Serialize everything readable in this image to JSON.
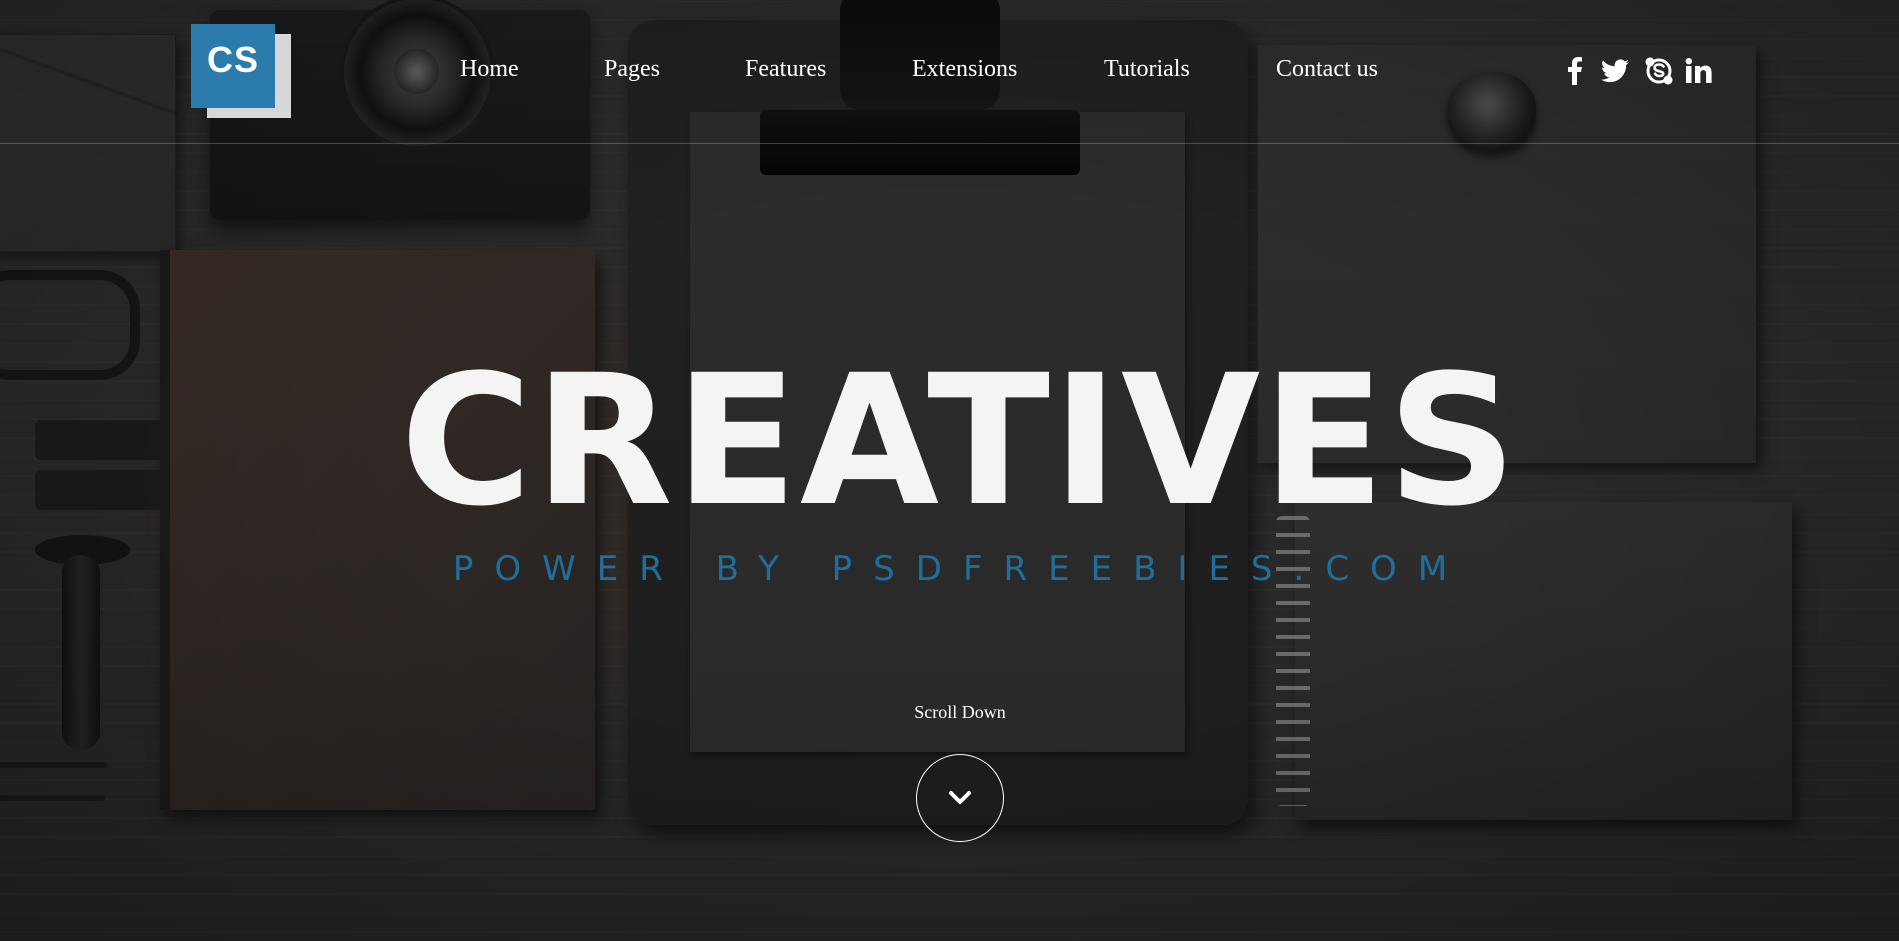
{
  "logo": {
    "text": "CS",
    "accent_color": "#2b7cac"
  },
  "nav": {
    "items": [
      {
        "label": "Home"
      },
      {
        "label": "Pages"
      },
      {
        "label": "Features"
      },
      {
        "label": "Extensions"
      },
      {
        "label": "Tutorials"
      },
      {
        "label": "Contact us"
      }
    ]
  },
  "socials": [
    {
      "icon": "facebook-icon"
    },
    {
      "icon": "twitter-icon"
    },
    {
      "icon": "skype-icon"
    },
    {
      "icon": "linkedin-icon"
    }
  ],
  "hero": {
    "title": "CREATIVES",
    "subtitle": "POWER BY PSDFREEBIES.COM",
    "subtitle_color": "#1f6e9c",
    "scroll_label": "Scroll Down",
    "scroll_icon": "chevron-down-icon"
  }
}
